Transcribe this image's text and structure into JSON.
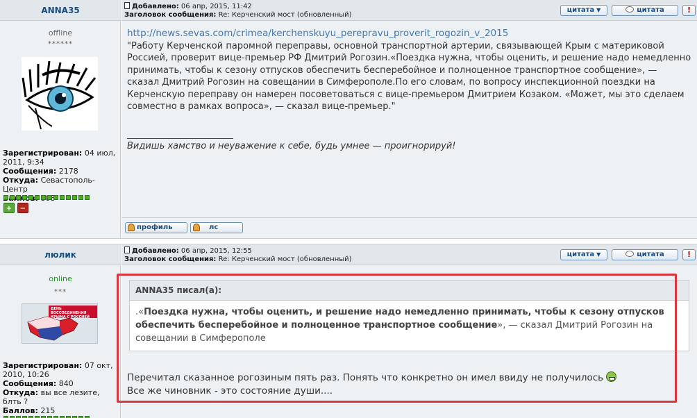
{
  "post1": {
    "author": "ANNA35",
    "status": "offline",
    "stars": "******",
    "added_label": "Добавлено:",
    "added_value": "06 апр, 2015, 11:42",
    "subject_label": "Заголовок сообщения:",
    "subject_value": "Re: Керченский мост (обновленный)",
    "registered_label": "Зарегистрирован:",
    "registered_value": "04 июл, 2011, 9:34",
    "posts_label": "Сообщения:",
    "posts_value": "2178",
    "from_label": "Откуда:",
    "from_value": "Севастополь-Центр",
    "points_label": "Баллов:",
    "points_value": "808",
    "link": "http://news.sevas.com/crimea/kerchenskuyu_perepravu_proverit_rogozin_v_2015",
    "text": "\"Работу Керченской паромной переправы, основной транспортной артерии, связывающей Крым с материковой Россией, проверит вице-премьер РФ Дмитрий Рогозин.«Поездка нужна, чтобы оценить, и решение надо немедленно принимать, чтобы к сезону отпусков обеспечить бесперебойное и полноценное транспортное сообщение», — сказал Дмитрий Рогозин на совещании в Симферополе.По его словам, по вопросу инспекционной поездки на Керченскую переправу он намерен посоветоваться с вице-премьером Дмитрием Козаком. «Может, мы это сделаем совместно в рамках вопроса», — сказал вице-премьер.\"",
    "signature": "Видишь хамство и неуважение к себе, будь умнее — проигнорируй!",
    "btn_quote_sel": "цитата",
    "btn_quote": "цитата",
    "btn_warn": "!",
    "btn_profile": "профиль",
    "btn_pm": "лс"
  },
  "post2": {
    "author": "люлик",
    "status": "online",
    "stars": "***",
    "added_label": "Добавлено:",
    "added_value": "06 апр, 2015, 12:55",
    "subject_label": "Заголовок сообщения:",
    "subject_value": "Re: Керченский мост (обновленный)",
    "registered_label": "Зарегистрирован:",
    "registered_value": "07 окт, 2010, 10:26",
    "posts_label": "Сообщения:",
    "posts_value": "840",
    "from_label": "Откуда:",
    "from_value": "вы все лезите, блть ?",
    "points_label": "Баллов:",
    "points_value": "215",
    "avatar_banner": "ДЕНЬ ВОССОЕДИНЕНИЯ КРЫМА С РОССИЕЙ",
    "quote_author": "ANNA35 писал(а):",
    "quote_prefix": ".«",
    "quote_bold": "Поездка нужна, чтобы оценить, и решение надо немедленно принимать, чтобы к сезону отпусков обеспечить бесперебойное и полноценное транспортное сообщение",
    "quote_suffix": "», — сказал Дмитрий Рогозин на совещании в Симферополе",
    "reply_line1": "Перечитал сказанное рогозиным пять раз. Понять что конкретно он имел ввиду не получилось",
    "reply_line2": "Все же чиновник - это состояние души....",
    "btn_quote_sel": "цитата",
    "btn_quote": "цитата",
    "btn_warn": "!"
  },
  "colors": {
    "highlight": "#d6383b",
    "link": "#3f78b5",
    "online": "#1f9a1f",
    "rep_green": "#4caf2a"
  }
}
